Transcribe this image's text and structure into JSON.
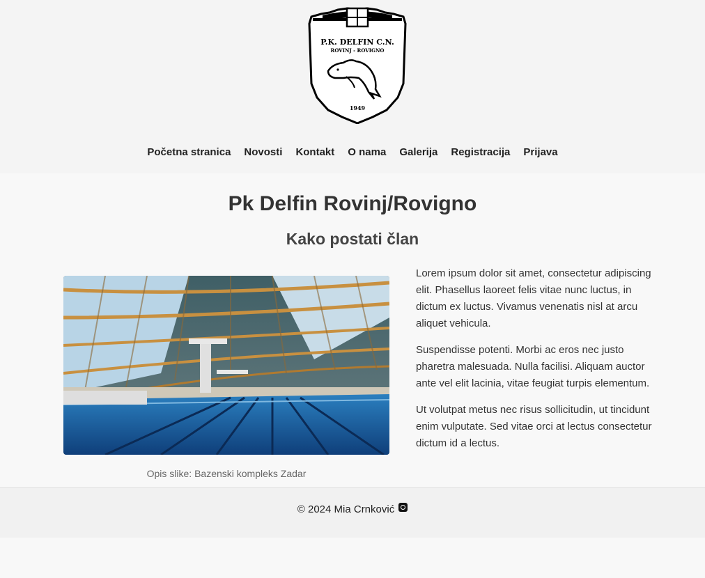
{
  "header": {
    "logo": {
      "icon": "club-crest-logo",
      "text_top": "P.K. DELFIN C.N.",
      "text_city": "ROVINJ - ROVIGNO",
      "year": "1949"
    },
    "nav": [
      {
        "label": "Početna stranica"
      },
      {
        "label": "Novosti"
      },
      {
        "label": "Kontakt"
      },
      {
        "label": "O nama"
      },
      {
        "label": "Galerija"
      },
      {
        "label": "Registracija"
      },
      {
        "label": "Prijava"
      }
    ]
  },
  "main": {
    "title": "Pk Delfin Rovinj/Rovigno",
    "subtitle": "Kako postati član",
    "image_caption": "Opis slike: Bazenski kompleks Zadar",
    "paragraphs": [
      "Lorem ipsum dolor sit amet, consectetur adipiscing elit. Phasellus laoreet felis vitae nunc luctus, in dictum ex luctus. Vivamus venenatis nisl at arcu aliquet vehicula.",
      "Suspendisse potenti. Morbi ac eros nec justo pharetra malesuada. Nulla facilisi. Aliquam auctor ante vel elit lacinia, vitae feugiat turpis elementum.",
      "Ut volutpat metus nec risus sollicitudin, ut tincidunt enim vulputate. Sed vitae orci at lectus consectetur dictum id a lectus."
    ]
  },
  "footer": {
    "copyright": "© 2024 Mia Crnković",
    "social_icon": "instagram-icon"
  },
  "colors": {
    "header_bg": "#f4f4f4",
    "page_bg": "#f8f8f8",
    "footer_bg": "#f1f1f1",
    "text": "#222222",
    "pool_blue": "#1d5fa3"
  }
}
